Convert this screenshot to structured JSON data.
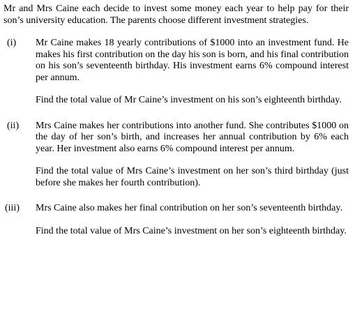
{
  "intro": "Mr and Mrs Caine each decide to invest some money each year to help pay for their son’s university education. The parents choose different investment strategies.",
  "parts": [
    {
      "number": "(i)",
      "statement": "Mr Caine makes 18 yearly contributions of $1000 into an investment fund. He makes his first contribution on the day his son is born, and his final contribution on his son’s seventeenth birthday. His investment earns 6% compound interest per annum.",
      "task": "Find the total value of Mr Caine’s investment on his son’s eighteenth birthday."
    },
    {
      "number": "(ii)",
      "statement": "Mrs Caine makes her contributions into another fund. She contributes $1000 on the day of her son’s birth, and increases her annual contribution by 6% each year. Her investment also earns 6% compound interest per annum.",
      "task": "Find the total value of Mrs Caine’s investment on her son’s third birthday (just before she makes her fourth contribution)."
    },
    {
      "number": "(iii)",
      "statement": "Mrs Caine also makes her final contribution on her son’s seventeenth birthday.",
      "task": "Find the total value of Mrs Caine’s investment on her son’s eighteenth birthday."
    }
  ]
}
